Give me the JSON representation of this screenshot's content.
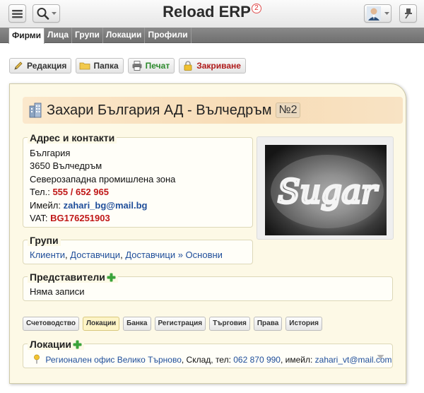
{
  "app": {
    "title": "Reload ERP",
    "notification_count": "2"
  },
  "nav": {
    "tabs": [
      "Фирми",
      "Лица",
      "Групи",
      "Локации",
      "Профили"
    ],
    "active": 0
  },
  "actions": {
    "edit": "Редакция",
    "folder": "Папка",
    "print": "Печат",
    "close": "Закриване"
  },
  "company": {
    "name": "Захари България АД - Вълчедръм",
    "number": "№2"
  },
  "address": {
    "title": "Адрес и контакти",
    "country": "България",
    "city": "3650 Вълчедръм",
    "zone": "Северозападна промишлена зона",
    "phone_label": "Тел.:",
    "phone": "555 / 652 965",
    "email_label": "Имейл:",
    "email": "zahari_bg@mail.bg",
    "vat_label": "VAT:",
    "vat": "BG176251903"
  },
  "photo": {
    "text": "Sugar"
  },
  "groups": {
    "title": "Групи",
    "items": [
      "Клиенти",
      "Доставчици",
      "Доставчици » Основни"
    ],
    "separator": ", "
  },
  "representatives": {
    "title": "Представители",
    "empty": "Няма записи"
  },
  "section_tabs": [
    "Счетоводство",
    "Локации",
    "Банка",
    "Регистрация",
    "Търговия",
    "Права",
    "История"
  ],
  "section_tabs_active": 1,
  "locations": {
    "title": "Локации",
    "item": {
      "name": "Регионален офис Велико Търново",
      "type": ", Склад, тел: ",
      "phone": "062 870 990",
      "email_label": ", имейл: ",
      "email": "zahari_vt@mail.com"
    }
  },
  "colors": {
    "accent_red": "#c01818",
    "link_blue": "#1f4e9a",
    "card_bg": "#fdf9e6",
    "add_green": "#3aa33a"
  }
}
